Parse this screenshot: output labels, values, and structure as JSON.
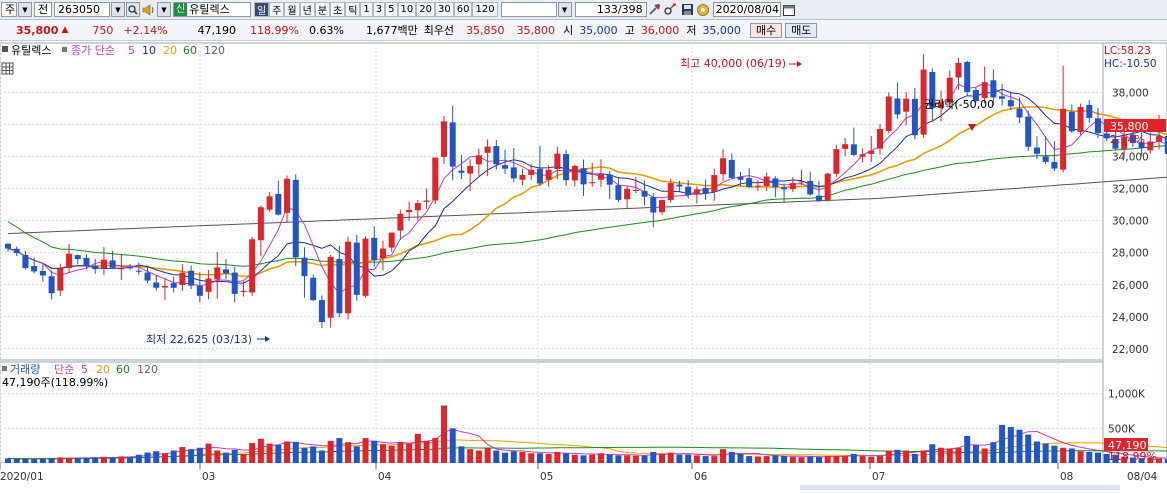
{
  "toolbar": {
    "type_label": "주",
    "prev_label": "전",
    "code": "263050",
    "badge": "신",
    "name": "유틸렉스",
    "periods": [
      "일",
      "주",
      "월",
      "년",
      "분",
      "초",
      "틱",
      "1",
      "3",
      "5",
      "10",
      "20",
      "30",
      "60",
      "120"
    ],
    "active_period": "일",
    "count": "133/398",
    "date": "2020/08/04"
  },
  "quote": {
    "price": "35,800",
    "change": "750",
    "change_pct": "+2.14%",
    "volume": "47,190",
    "vol_ratio": "118.99%",
    "turnover": "0.63%",
    "amount": "1,677백만",
    "priority_label": "최우선",
    "ask": "35,850",
    "bid": "35,800",
    "open_label": "시",
    "open": "35,000",
    "high_label": "고",
    "high": "36,000",
    "low_label": "저",
    "low": "35,000",
    "buy_label": "매수",
    "sell_label": "매도"
  },
  "legend": {
    "name": "유틸렉스",
    "price_label": "종가 단순",
    "ma": [
      "5",
      "10",
      "20",
      "60",
      "120"
    ],
    "lc": "LC:58.23",
    "hc": "HC:-10.50"
  },
  "volume_legend": {
    "title": "거래량",
    "ma_label": "단순",
    "ma": [
      "5",
      "20",
      "60",
      "120"
    ],
    "value": "47,190주(118.99%)"
  },
  "annotations": {
    "high": "최고 40,000 (06/19)",
    "low": "최저 22,625 (03/13)",
    "rights": "권리락(-50,00"
  },
  "chart_data": {
    "type": "candlestick",
    "price_axis": [
      "38,000",
      "36,000",
      "34,000",
      "32,000",
      "30,000",
      "28,000",
      "26,000",
      "24,000",
      "22,000"
    ],
    "price_ticks": [
      38000,
      36000,
      34000,
      32000,
      30000,
      28000,
      26000,
      24000,
      22000
    ],
    "ylim": [
      21300,
      41100
    ],
    "volume_axis": [
      "1,000K",
      "500K"
    ],
    "volume_ticks": [
      1000000,
      500000
    ],
    "volume_max": 1400000,
    "x_labels": [
      "2020/01",
      "03",
      "04",
      "05",
      "06",
      "07",
      "08",
      "08/04"
    ],
    "last_price_label": "35,800",
    "last_pct_label": "2.14%",
    "last_volume_label": "47,190",
    "last_volume_pct": "118.99%",
    "colors": {
      "up": "#e0242a",
      "down": "#1f55c8",
      "ma5": "#c43cc4",
      "ma10": "#1c2f9a",
      "ma20": "#e6a000",
      "ma60": "#1f8a1f",
      "ma120": "#555555"
    },
    "ohlc": [
      [
        28560,
        28590,
        28080,
        28260
      ],
      [
        28250,
        28390,
        27800,
        27980
      ],
      [
        27860,
        28110,
        26950,
        27040
      ],
      [
        27170,
        27700,
        26720,
        26830
      ],
      [
        26860,
        27320,
        26190,
        26580
      ],
      [
        26530,
        26890,
        25080,
        25470
      ],
      [
        25630,
        27310,
        25290,
        27010
      ],
      [
        27040,
        28560,
        26740,
        27940
      ],
      [
        27850,
        27880,
        27280,
        27610
      ],
      [
        27680,
        27890,
        26990,
        27140
      ],
      [
        27180,
        27620,
        26680,
        26980
      ],
      [
        27040,
        28360,
        26610,
        27570
      ],
      [
        27520,
        28120,
        27010,
        27060
      ],
      [
        26980,
        27920,
        26310,
        27030
      ],
      [
        27090,
        27290,
        26940,
        27040
      ],
      [
        26880,
        27380,
        26630,
        26810
      ],
      [
        26760,
        27150,
        26100,
        26260
      ],
      [
        26140,
        26610,
        25640,
        25810
      ],
      [
        25830,
        26450,
        25060,
        25930
      ],
      [
        26100,
        26500,
        25520,
        25810
      ],
      [
        25990,
        27290,
        25620,
        26750
      ],
      [
        26880,
        27200,
        25730,
        25950
      ],
      [
        25930,
        26780,
        24900,
        25310
      ],
      [
        25560,
        26920,
        25100,
        26390
      ],
      [
        26330,
        28040,
        25130,
        27090
      ],
      [
        26960,
        27600,
        26360,
        26700
      ],
      [
        26760,
        27120,
        24920,
        25430
      ],
      [
        25550,
        26210,
        25260,
        25620
      ],
      [
        25520,
        28980,
        25300,
        28840
      ],
      [
        28780,
        30950,
        27790,
        30840
      ],
      [
        30690,
        31790,
        30560,
        31520
      ],
      [
        31670,
        32510,
        30330,
        30380
      ],
      [
        30490,
        32830,
        29880,
        32620
      ],
      [
        32550,
        32900,
        27160,
        27720
      ],
      [
        27690,
        28340,
        25190,
        26540
      ],
      [
        26440,
        26640,
        24990,
        25040
      ],
      [
        25040,
        25330,
        23300,
        23670
      ],
      [
        23940,
        27860,
        23320,
        27740
      ],
      [
        27610,
        28430,
        23980,
        24220
      ],
      [
        24220,
        28990,
        23820,
        28690
      ],
      [
        28630,
        29110,
        25000,
        25370
      ],
      [
        25310,
        29010,
        25210,
        28880
      ],
      [
        28930,
        29660,
        27130,
        27550
      ],
      [
        27670,
        28750,
        26900,
        28260
      ],
      [
        28320,
        29260,
        28070,
        29260
      ],
      [
        29380,
        30690,
        28800,
        30430
      ],
      [
        30540,
        31190,
        30000,
        30680
      ],
      [
        30650,
        31290,
        30030,
        31100
      ],
      [
        31180,
        32010,
        30730,
        31260
      ],
      [
        31270,
        33960,
        31040,
        33940
      ],
      [
        33990,
        36530,
        33540,
        36210
      ],
      [
        36140,
        37180,
        32520,
        33380
      ],
      [
        33130,
        34120,
        32600,
        32990
      ],
      [
        32950,
        33830,
        31860,
        33420
      ],
      [
        33520,
        34500,
        32800,
        34090
      ],
      [
        34240,
        35080,
        32790,
        34630
      ],
      [
        34660,
        35040,
        33200,
        33520
      ],
      [
        33470,
        34440,
        32920,
        33250
      ],
      [
        33330,
        34540,
        32390,
        32640
      ],
      [
        32560,
        33250,
        32230,
        32850
      ],
      [
        32860,
        33530,
        32550,
        33180
      ],
      [
        33240,
        34670,
        32160,
        32330
      ],
      [
        32550,
        33460,
        32120,
        33190
      ],
      [
        33230,
        34620,
        32590,
        34190
      ],
      [
        34160,
        34420,
        32180,
        32530
      ],
      [
        32520,
        33510,
        32140,
        33420
      ],
      [
        33280,
        33820,
        31550,
        32270
      ],
      [
        32340,
        33620,
        32120,
        32410
      ],
      [
        32560,
        33830,
        32100,
        32920
      ],
      [
        32880,
        33100,
        31350,
        32250
      ],
      [
        32220,
        32740,
        31160,
        31300
      ],
      [
        31340,
        32200,
        30750,
        31990
      ],
      [
        31860,
        32730,
        31730,
        31920
      ],
      [
        31860,
        32510,
        30950,
        31500
      ],
      [
        31470,
        31740,
        29600,
        30510
      ],
      [
        30530,
        31320,
        30370,
        31290
      ],
      [
        31290,
        32630,
        31120,
        32350
      ],
      [
        32260,
        32500,
        31840,
        32140
      ],
      [
        32120,
        32540,
        31380,
        31600
      ],
      [
        31650,
        32150,
        31090,
        31960
      ],
      [
        32040,
        32570,
        31300,
        31720
      ],
      [
        31800,
        33260,
        31250,
        32850
      ],
      [
        32910,
        34460,
        32480,
        33900
      ],
      [
        33800,
        34210,
        32620,
        32680
      ],
      [
        32730,
        33050,
        32170,
        32560
      ],
      [
        32660,
        33280,
        32070,
        32100
      ],
      [
        32130,
        32530,
        31860,
        32190
      ],
      [
        32170,
        33010,
        31860,
        32760
      ],
      [
        32640,
        32780,
        31470,
        32100
      ],
      [
        32090,
        32320,
        31150,
        31960
      ],
      [
        31970,
        32720,
        31800,
        32350
      ],
      [
        32390,
        33160,
        32220,
        32450
      ],
      [
        32480,
        33070,
        31570,
        31640
      ],
      [
        31560,
        32470,
        31180,
        31240
      ],
      [
        31300,
        33000,
        31190,
        32940
      ],
      [
        32930,
        34750,
        32740,
        34470
      ],
      [
        34490,
        35170,
        34040,
        34780
      ],
      [
        34770,
        35820,
        34030,
        34110
      ],
      [
        34000,
        34520,
        33630,
        34150
      ],
      [
        34170,
        35300,
        33670,
        34380
      ],
      [
        34500,
        36040,
        34130,
        35730
      ],
      [
        35610,
        38010,
        35480,
        37760
      ],
      [
        37630,
        38640,
        36370,
        36640
      ],
      [
        36810,
        38030,
        35960,
        37620
      ],
      [
        37610,
        38290,
        35090,
        35340
      ],
      [
        35380,
        40400,
        35170,
        39440
      ],
      [
        39290,
        39510,
        36170,
        37020
      ],
      [
        37040,
        38140,
        36210,
        37420
      ],
      [
        37380,
        39390,
        36970,
        38930
      ],
      [
        38950,
        40160,
        38180,
        39860
      ],
      [
        39910,
        40000,
        37800,
        38040
      ],
      [
        38160,
        38330,
        37390,
        37480
      ],
      [
        37660,
        39620,
        37330,
        38660
      ],
      [
        38770,
        39450,
        37210,
        37700
      ],
      [
        37770,
        38530,
        37190,
        37620
      ],
      [
        37530,
        38080,
        36910,
        37140
      ],
      [
        37000,
        37700,
        36090,
        36450
      ],
      [
        36500,
        36870,
        34350,
        34620
      ],
      [
        34570,
        35270,
        33860,
        34180
      ],
      [
        34020,
        35300,
        33530,
        33670
      ],
      [
        33670,
        34970,
        33100,
        33260
      ],
      [
        33190,
        39680,
        33020,
        36990
      ],
      [
        36810,
        37250,
        35480,
        35580
      ],
      [
        35550,
        37320,
        35360,
        37100
      ],
      [
        37230,
        37530,
        36120,
        36420
      ],
      [
        36390,
        37050,
        35150,
        35470
      ],
      [
        35450,
        36180,
        34970,
        35140
      ],
      [
        35110,
        35960,
        34420,
        34500
      ],
      [
        34480,
        35740,
        34000,
        35250
      ],
      [
        35380,
        36230,
        34610,
        34850
      ],
      [
        34870,
        35520,
        34060,
        34530
      ],
      [
        34400,
        35500,
        34190,
        34950
      ],
      [
        34950,
        36600,
        34450,
        35290
      ],
      [
        35290,
        35380,
        33590,
        34180
      ],
      [
        34280,
        35520,
        34110,
        34610
      ],
      [
        34470,
        37760,
        34110,
        36510
      ],
      [
        36460,
        37240,
        35720,
        36170
      ],
      [
        36220,
        38170,
        36140,
        38030
      ],
      [
        37920,
        38680,
        37220,
        37310
      ],
      [
        37360,
        37980,
        36730,
        37380
      ],
      [
        37330,
        37640,
        36180,
        36700
      ],
      [
        36670,
        36690,
        35240,
        35770
      ],
      [
        35770,
        36320,
        34700,
        34990
      ],
      [
        34970,
        35370,
        34600,
        34950
      ],
      [
        35050,
        35930,
        35000,
        35830
      ]
    ],
    "volume": [
      67000,
      60000,
      58000,
      55000,
      65000,
      70000,
      80000,
      75000,
      68000,
      72000,
      82000,
      90000,
      85000,
      95000,
      88000,
      120000,
      150000,
      170000,
      140000,
      180000,
      230000,
      200000,
      220000,
      280000,
      180000,
      150000,
      190000,
      130000,
      290000,
      350000,
      280000,
      260000,
      310000,
      300000,
      220000,
      240000,
      180000,
      320000,
      360000,
      300000,
      240000,
      360000,
      320000,
      270000,
      250000,
      300000,
      280000,
      420000,
      320000,
      360000,
      830000,
      500000,
      240000,
      200000,
      180000,
      210000,
      180000,
      150000,
      170000,
      160000,
      140000,
      140000,
      130000,
      160000,
      140000,
      120000,
      110000,
      120000,
      140000,
      120000,
      110000,
      110000,
      105000,
      105000,
      160000,
      130000,
      150000,
      120000,
      120000,
      110000,
      100000,
      100000,
      200000,
      160000,
      130000,
      100000,
      95000,
      100000,
      110000,
      100000,
      90000,
      85000,
      92000,
      90000,
      100000,
      100000,
      100000,
      130000,
      100000,
      90000,
      100000,
      180000,
      190000,
      180000,
      130000,
      180000,
      270000,
      220000,
      210000,
      220000,
      390000,
      260000,
      210000,
      300000,
      550000,
      520000,
      480000,
      410000,
      310000,
      280000,
      250000,
      220000,
      210000,
      170000,
      160000,
      150000,
      130000,
      120000,
      90000,
      80000,
      70000,
      75000,
      65000,
      60000,
      62000,
      58000,
      57000,
      52000,
      50000,
      47190
    ]
  }
}
